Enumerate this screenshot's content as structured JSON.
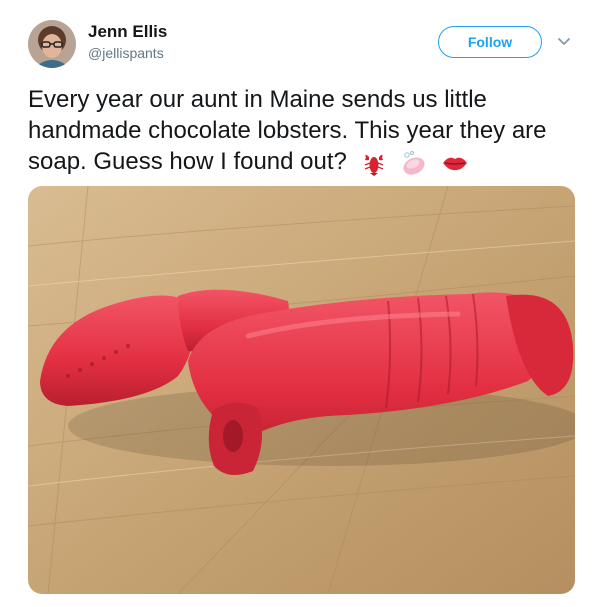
{
  "user": {
    "name": "Jenn Ellis",
    "handle": "@jellispants"
  },
  "follow_button_label": "Follow",
  "tweet": {
    "text": "Every year our aunt in Maine sends us little handmade chocolate lobsters. This year they are soap. Guess how I found out?",
    "emojis": [
      "lobster-emoji",
      "soap-emoji",
      "lips-emoji"
    ]
  },
  "colors": {
    "accent": "#1da1f2",
    "text": "#14171a",
    "muted": "#657786",
    "lobster": "#e8313f",
    "wood": "#c9a77b"
  }
}
